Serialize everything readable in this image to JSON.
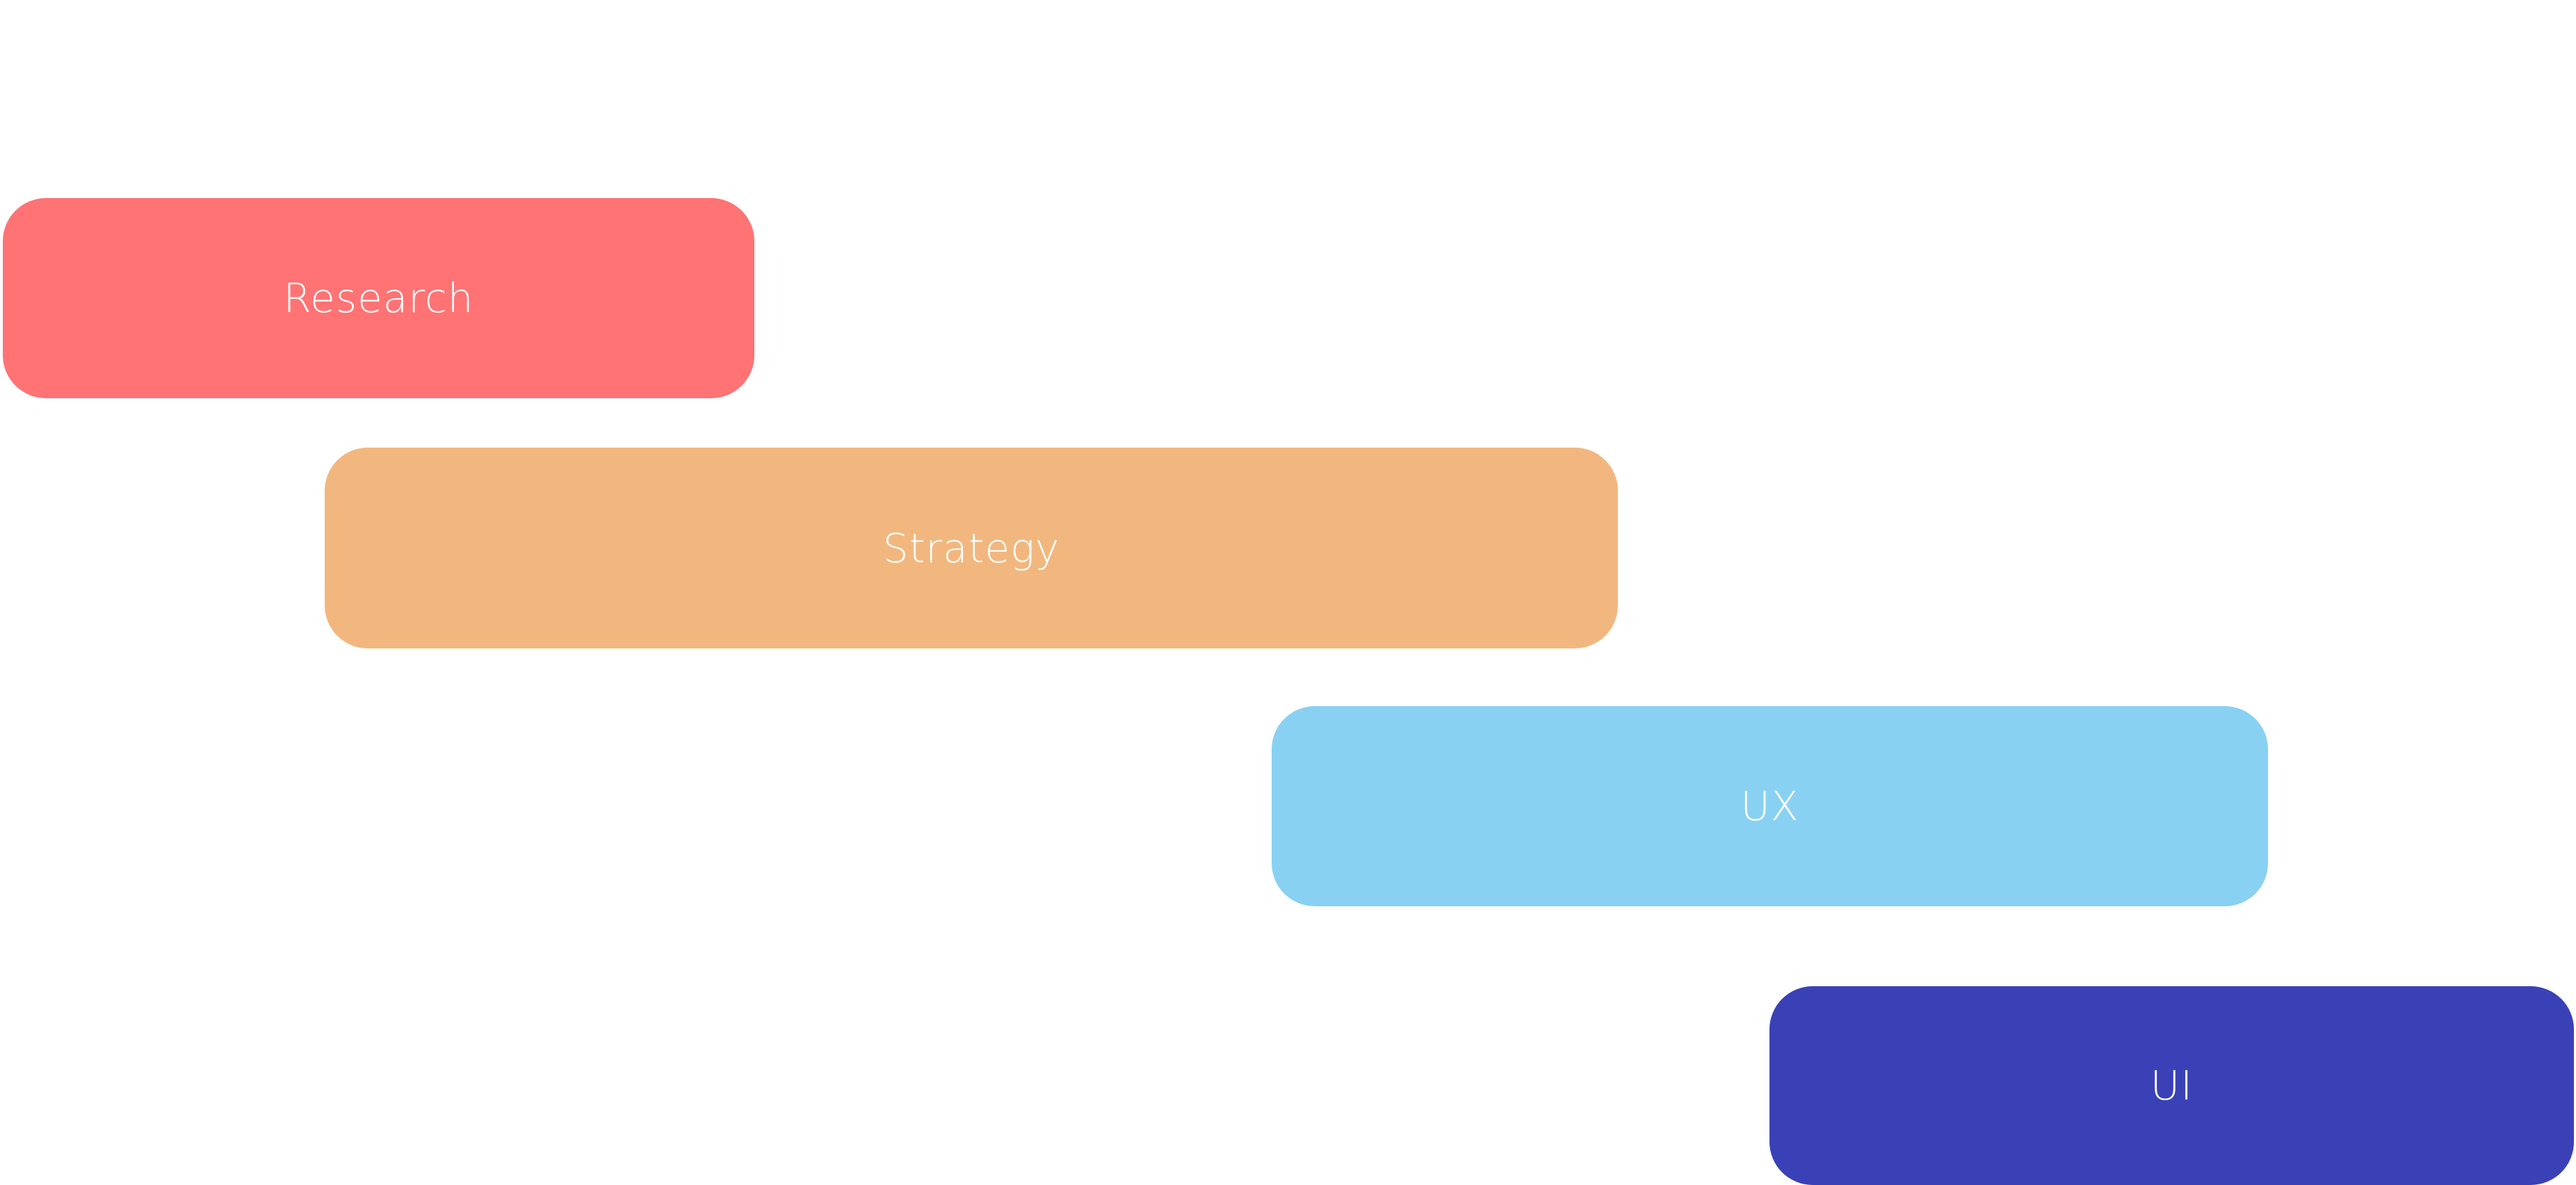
{
  "phases": [
    {
      "id": "research",
      "label": "Research",
      "color": "#FF7374"
    },
    {
      "id": "strategy",
      "label": "Strategy",
      "color": "#F2B77E"
    },
    {
      "id": "ux",
      "label": "UX",
      "color": "#89D1F2"
    },
    {
      "id": "ui",
      "label": "UI",
      "color": "#3A41B6"
    }
  ]
}
